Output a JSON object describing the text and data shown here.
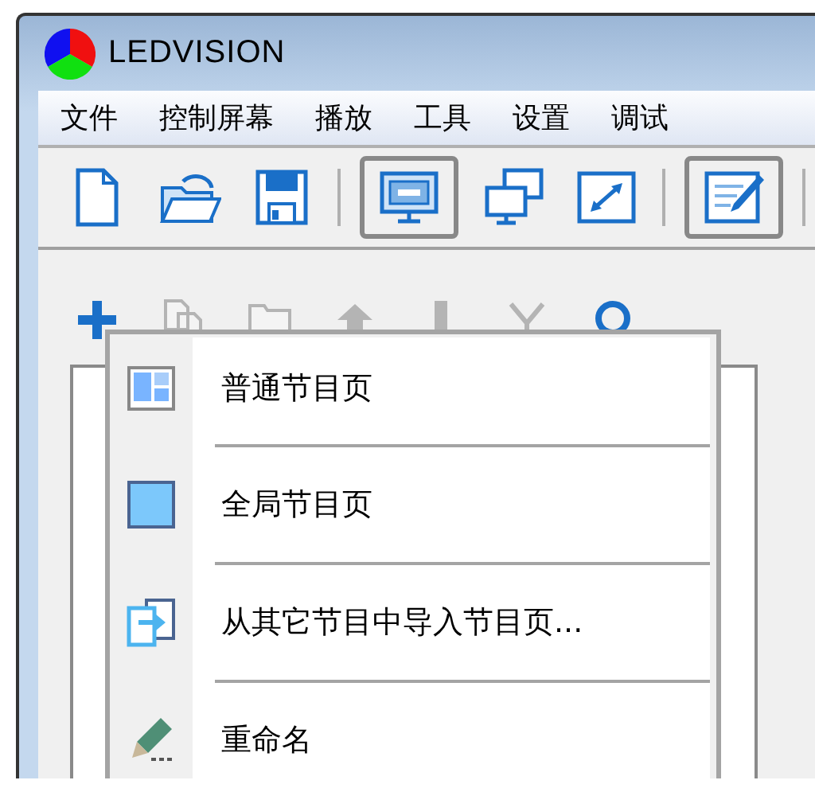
{
  "window": {
    "title": "LEDVISION"
  },
  "menu_bar": [
    "文件",
    "控制屏幕",
    "播放",
    "工具",
    "设置",
    "调试"
  ],
  "toolbar": [
    {
      "kind": "new",
      "pressed": false
    },
    {
      "kind": "open",
      "pressed": false
    },
    {
      "kind": "save",
      "pressed": false
    },
    {
      "kind": "separator"
    },
    {
      "kind": "screen",
      "pressed": true
    },
    {
      "kind": "screens",
      "pressed": false
    },
    {
      "kind": "expand",
      "pressed": false
    },
    {
      "kind": "separator"
    },
    {
      "kind": "edit",
      "pressed": true
    },
    {
      "kind": "separator"
    }
  ],
  "page_toolbar": [
    {
      "kind": "add",
      "disabled": false
    },
    {
      "kind": "copy",
      "disabled": true
    },
    {
      "kind": "folder",
      "disabled": true
    },
    {
      "kind": "up",
      "disabled": true
    },
    {
      "kind": "down",
      "disabled": true
    },
    {
      "kind": "delete",
      "disabled": true
    },
    {
      "kind": "search",
      "disabled": false
    }
  ],
  "context_menu": [
    {
      "kind": "normal-page",
      "label": "普通节目页"
    },
    {
      "kind": "global-page",
      "label": "全局节目页"
    },
    {
      "kind": "import",
      "label": "从其它节目中导入节目页..."
    },
    {
      "kind": "rename",
      "label": "重命名"
    }
  ]
}
